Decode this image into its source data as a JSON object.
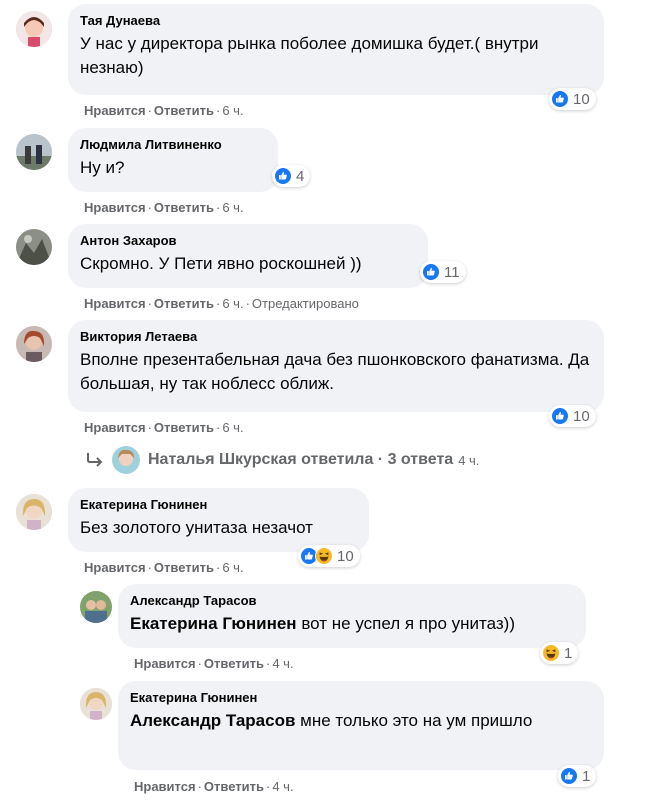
{
  "labels": {
    "like": "Нравится",
    "reply": "Ответить",
    "dot": "·"
  },
  "colors": {
    "like_blue": "#1877f2",
    "haha_yellow": "#f7b928",
    "bubble_bg": "#f0f2f5",
    "meta_gray": "#65676b"
  },
  "comments": [
    {
      "author": "Тая Дунаева",
      "text": "У нас у директора рынка поболее домишка будет.( внутри незнаю)",
      "time": "6 ч.",
      "reactions": {
        "icons": [
          "like-icon"
        ],
        "count": "10"
      }
    },
    {
      "author": "Людмила Литвиненко",
      "text": "Ну и?",
      "time": "6 ч.",
      "reactions": {
        "icons": [
          "like-icon"
        ],
        "count": "4"
      }
    },
    {
      "author": "Антон Захаров",
      "text": "Скромно. У Пети явно роскошней ))",
      "time": "6 ч.",
      "edited": "Отредактировано",
      "reactions": {
        "icons": [
          "like-icon"
        ],
        "count": "11"
      }
    },
    {
      "author": "Виктория Летаева",
      "text": "Вполне презентабельная дача без пшонковского фанатизма. Да большая, ну так ноблесс оближ.",
      "time": "6 ч.",
      "reactions": {
        "icons": [
          "like-icon"
        ],
        "count": "10"
      },
      "replies_summary": {
        "text": "Наталья Шкурская ответила · 3 ответа",
        "time": "4 ч."
      }
    },
    {
      "author": "Екатерина Гюнинен",
      "text": "Без золотого унитаза незачот",
      "time": "6 ч.",
      "reactions": {
        "icons": [
          "like-icon",
          "haha-icon"
        ],
        "count": "10"
      }
    }
  ],
  "replies": [
    {
      "author": "Александр Тарасов",
      "mention": "Екатерина Гюнинен",
      "text": " вот не успел я про унитаз))",
      "time": "4 ч.",
      "reactions": {
        "icons": [
          "haha-icon"
        ],
        "count": "1"
      }
    },
    {
      "author": "Екатерина Гюнинен",
      "mention": "Александр Тарасов",
      "text": " мне только это на ум пришло",
      "time": "4 ч.",
      "reactions": {
        "icons": [
          "like-icon"
        ],
        "count": "1"
      }
    }
  ]
}
